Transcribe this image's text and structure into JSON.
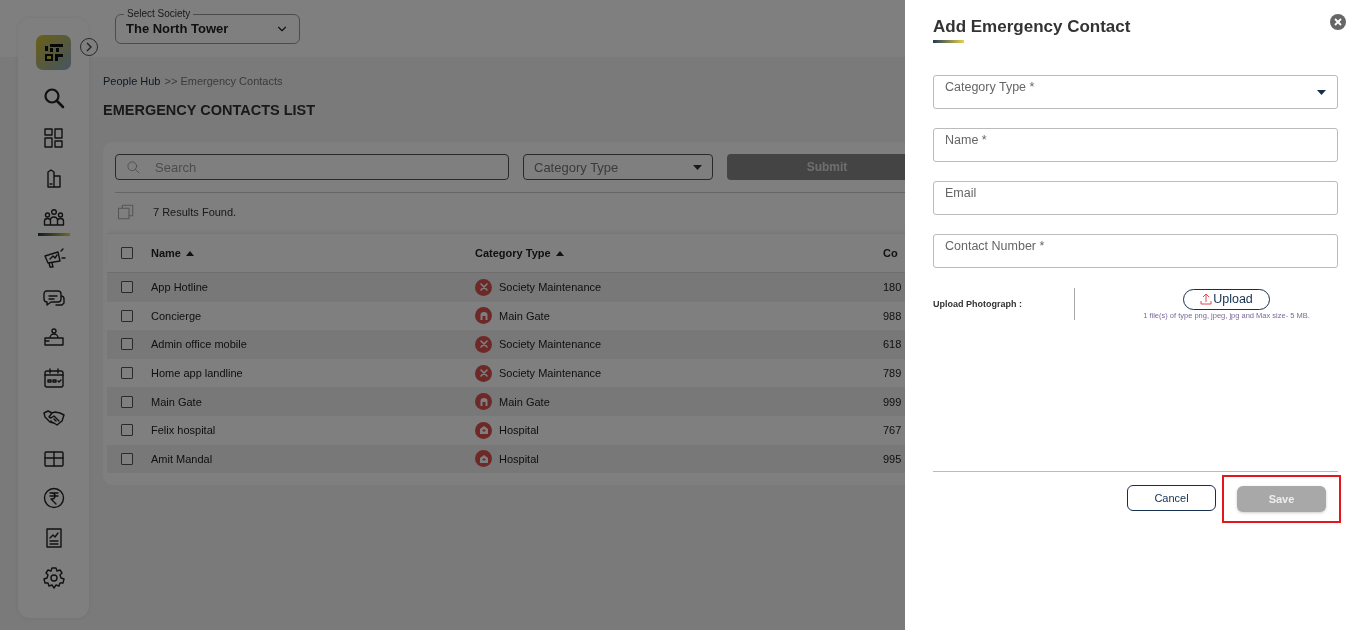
{
  "sidebar": {
    "items": [
      {
        "selected": false
      },
      {
        "selected": false
      },
      {
        "selected": false
      },
      {
        "selected": true
      },
      {
        "selected": false
      },
      {
        "selected": false
      },
      {
        "selected": false
      },
      {
        "selected": false
      },
      {
        "selected": false
      },
      {
        "selected": false
      },
      {
        "selected": false
      },
      {
        "selected": false
      },
      {
        "selected": false
      }
    ]
  },
  "header": {
    "society_select": {
      "label": "Select Society",
      "value": "The North Tower"
    }
  },
  "breadcrumb": {
    "link": "People Hub",
    "current": ">> Emergency Contacts"
  },
  "page_title": "EMERGENCY CONTACTS LIST",
  "filters": {
    "search": {
      "placeholder": "Search"
    },
    "category": {
      "placeholder": "Category Type"
    },
    "submit": "Submit"
  },
  "results_count": "7 Results Found.",
  "table": {
    "all_checked": false,
    "columns": [
      {
        "label": "Name",
        "sortable": true
      },
      {
        "label": "Category Type",
        "sortable": true
      },
      {
        "label": "Co",
        "sortable": false
      }
    ],
    "rows": [
      {
        "name": "App Hotline",
        "category": "Society Maintenance",
        "kind": "tools",
        "contact": "180",
        "checked": false
      },
      {
        "name": "Concierge",
        "category": "Main Gate",
        "kind": "gate",
        "contact": "988",
        "checked": false
      },
      {
        "name": "Admin office mobile",
        "category": "Society Maintenance",
        "kind": "tools",
        "contact": "618",
        "checked": false
      },
      {
        "name": "Home app landline",
        "category": "Society Maintenance",
        "kind": "tools",
        "contact": "789",
        "checked": false
      },
      {
        "name": "Main Gate",
        "category": "Main Gate",
        "kind": "gate",
        "contact": "999",
        "checked": false
      },
      {
        "name": "Felix hospital",
        "category": "Hospital",
        "kind": "hospital",
        "contact": "767",
        "checked": false
      },
      {
        "name": "Amit Mandal",
        "category": "Hospital",
        "kind": "hospital",
        "contact": "995",
        "checked": false
      }
    ]
  },
  "dialog": {
    "title": "Add Emergency Contact",
    "fields": [
      {
        "kind": "select",
        "placeholder": "Category Type *"
      },
      {
        "kind": "text",
        "placeholder": "Name *"
      },
      {
        "kind": "text",
        "placeholder": "Email"
      },
      {
        "kind": "text",
        "placeholder": "Contact Number *"
      }
    ],
    "upload": {
      "label": "Upload Photograph :",
      "button": "Upload",
      "hint": "1 file(s) of type png, jpeg, jpg and Max size- 5 MB."
    },
    "buttons": [
      {
        "label": "Cancel",
        "kind": "outline"
      },
      {
        "label": "Save",
        "kind": "filled",
        "disabled": true,
        "highlighted": true
      }
    ]
  }
}
